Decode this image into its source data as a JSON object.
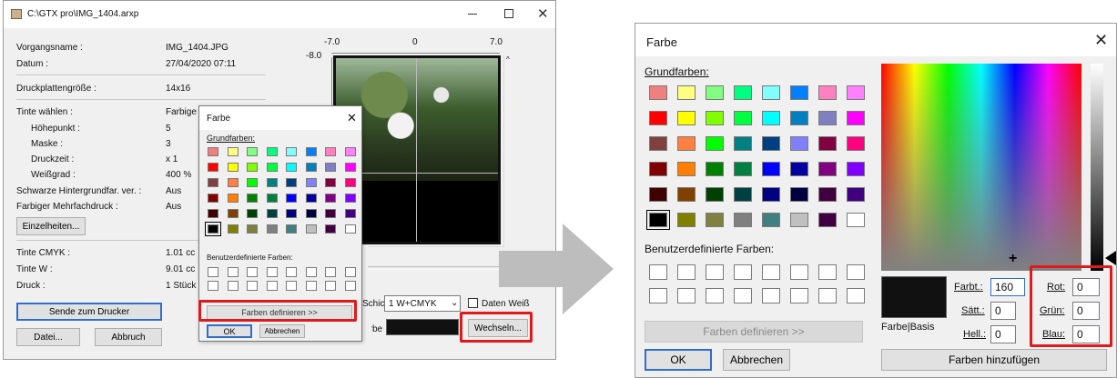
{
  "main_window": {
    "title": "C:\\GTX pro\\IMG_1404.arxp",
    "info": [
      {
        "label": "Vorgangsname :",
        "value": "IMG_1404.JPG"
      },
      {
        "label": "Datum :",
        "value": "27/04/2020 07:11"
      },
      {
        "label": "Druckplattengröße :",
        "value": "14x16"
      },
      {
        "label": "Tinte wählen :",
        "value": "Farbige + Weiße Tinte"
      },
      {
        "label": "Höhepunkt :",
        "value": "5"
      },
      {
        "label": "Maske :",
        "value": "3"
      },
      {
        "label": "Druckzeit :",
        "value": "x 1"
      },
      {
        "label": "Weißgrad :",
        "value": "400 %"
      },
      {
        "label": "Schwarze Hintergrundfar. ver. :",
        "value": "Aus"
      },
      {
        "label": "Farbiger Mehrfachdruck :",
        "value": "Aus"
      },
      {
        "label": "Tinte CMYK :",
        "value": "1.01 cc"
      },
      {
        "label": "Tinte W :",
        "value": "9.01 cc"
      },
      {
        "label": "Druck :",
        "value": "1 Stück"
      }
    ],
    "details_button": "Einzelheiten...",
    "send_button": "Sende zum Drucker",
    "file_button": "Datei...",
    "abort_button": "Abbruch",
    "ruler_top": [
      "-7.0",
      "0",
      "7.0"
    ],
    "ruler_left": "-8.0",
    "layer_label": "Schicht",
    "layer_select": "1  W+CMYK",
    "white_data_label": "Daten Weiß",
    "color_label": "Farbe",
    "change_button": "Wechseln..."
  },
  "small_dialog": {
    "title": "Farbe",
    "basic_colors_label": "Grundfarben:",
    "custom_colors_label": "Benutzerdefinierte Farben:",
    "define_button": "Farben definieren >>",
    "ok_button": "OK",
    "cancel_button": "Abbrechen"
  },
  "large_dialog": {
    "title": "Farbe",
    "basic_colors_label": "Grundfarben:",
    "custom_colors_label": "Benutzerdefinierte Farben:",
    "define_button": "Farben definieren >>",
    "ok_button": "OK",
    "cancel_button": "Abbrechen",
    "add_button": "Farben hinzufügen",
    "preview_label": "Farbe|Basis",
    "hue_label": "Farbt.:",
    "hue_value": "160",
    "sat_label": "Sätt.:",
    "sat_value": "0",
    "lum_label": "Hell.:",
    "lum_value": "0",
    "red_label": "Rot:",
    "red_value": "0",
    "green_label": "Grün:",
    "green_value": "0",
    "blue_label": "Blau:",
    "blue_value": "0"
  },
  "palette": [
    [
      "#f08080",
      "#ffff80",
      "#80ff80",
      "#00ff80",
      "#80ffff",
      "#0080ff",
      "#ff80c0",
      "#ff80ff"
    ],
    [
      "#ff0000",
      "#ffff00",
      "#80ff00",
      "#00ff40",
      "#00ffff",
      "#0080c0",
      "#8080c0",
      "#ff00ff"
    ],
    [
      "#804040",
      "#ff8040",
      "#00ff00",
      "#008080",
      "#004080",
      "#8080ff",
      "#800040",
      "#ff0080"
    ],
    [
      "#800000",
      "#ff8000",
      "#008000",
      "#008040",
      "#0000ff",
      "#0000a0",
      "#800080",
      "#8000ff"
    ],
    [
      "#400000",
      "#804000",
      "#004000",
      "#004040",
      "#000080",
      "#000040",
      "#400040",
      "#400080"
    ],
    [
      "#000000",
      "#808000",
      "#808040",
      "#808080",
      "#408080",
      "#c0c0c0",
      "#400040",
      "#ffffff"
    ]
  ],
  "colors": {
    "highlight": "#e0191c",
    "arrow": "#bdbdbd",
    "selected_swatch": "#000000"
  }
}
